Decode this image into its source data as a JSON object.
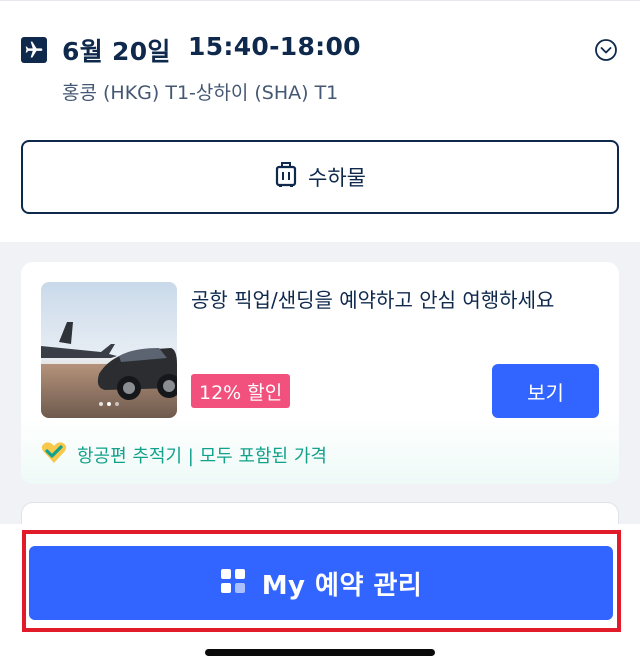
{
  "flight": {
    "date": "6월 20일",
    "time": "15:40-18:00",
    "route": "홍콩 (HKG) T1-상하이 (SHA) T1"
  },
  "baggage": {
    "label": "수하물"
  },
  "promo": {
    "title": "공항 픽업/샌딩을 예약하고 안심 여행하세요",
    "discount": "12% 할인",
    "view_label": "보기",
    "tracker_text": "항공편 추적기 | 모두 포함된 가격"
  },
  "bottom": {
    "manage_label": "My 예약 관리"
  },
  "colors": {
    "primary": "#3264ff",
    "navy": "#0f294d",
    "discount": "#f2517d",
    "tracker": "#12a18b",
    "highlight": "#e21b2b"
  },
  "icons": {
    "flight": "airplane-icon",
    "expand": "chevron-down-circle-icon",
    "baggage": "luggage-icon",
    "tracker": "heart-check-icon",
    "manage": "grid-icon"
  }
}
